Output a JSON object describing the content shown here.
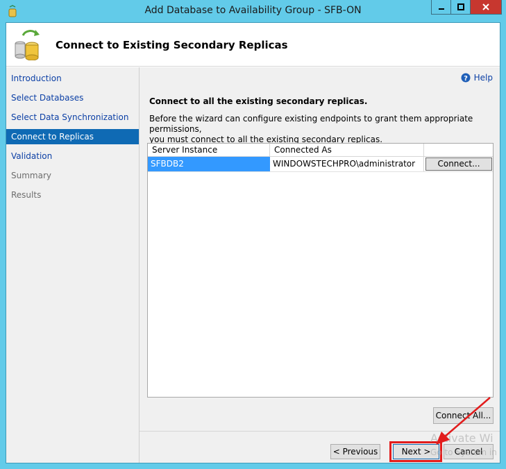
{
  "window": {
    "title": "Add Database to Availability Group - SFB-ON"
  },
  "header": {
    "title": "Connect to Existing Secondary Replicas"
  },
  "nav": {
    "items": [
      {
        "label": "Introduction"
      },
      {
        "label": "Select Databases"
      },
      {
        "label": "Select Data Synchronization"
      },
      {
        "label": "Connect to Replicas"
      },
      {
        "label": "Validation"
      },
      {
        "label": "Summary"
      },
      {
        "label": "Results"
      }
    ]
  },
  "content": {
    "help_label": "Help",
    "heading": "Connect to all the existing secondary replicas.",
    "description_line1": "Before the wizard can configure existing endpoints to grant them appropriate permissions,",
    "description_line2": "you must connect to all the existing secondary replicas."
  },
  "grid": {
    "columns": [
      "Server Instance",
      "Connected As",
      ""
    ],
    "rows": [
      {
        "server": "SFBDB2",
        "connected_as": "WINDOWSTECHPRO\\administrator",
        "action": "Connect..."
      }
    ]
  },
  "buttons": {
    "connect_all": "Connect All...",
    "previous": "< Previous",
    "next": "Next >",
    "cancel": "Cancel"
  },
  "watermark": {
    "line1": "Activate Wi",
    "line2": "Go to System in"
  },
  "colors": {
    "titlebar": "#62cbe9",
    "nav_selected": "#0f6ab4",
    "row_selected": "#3399ff",
    "highlight": "#e21c1c"
  }
}
